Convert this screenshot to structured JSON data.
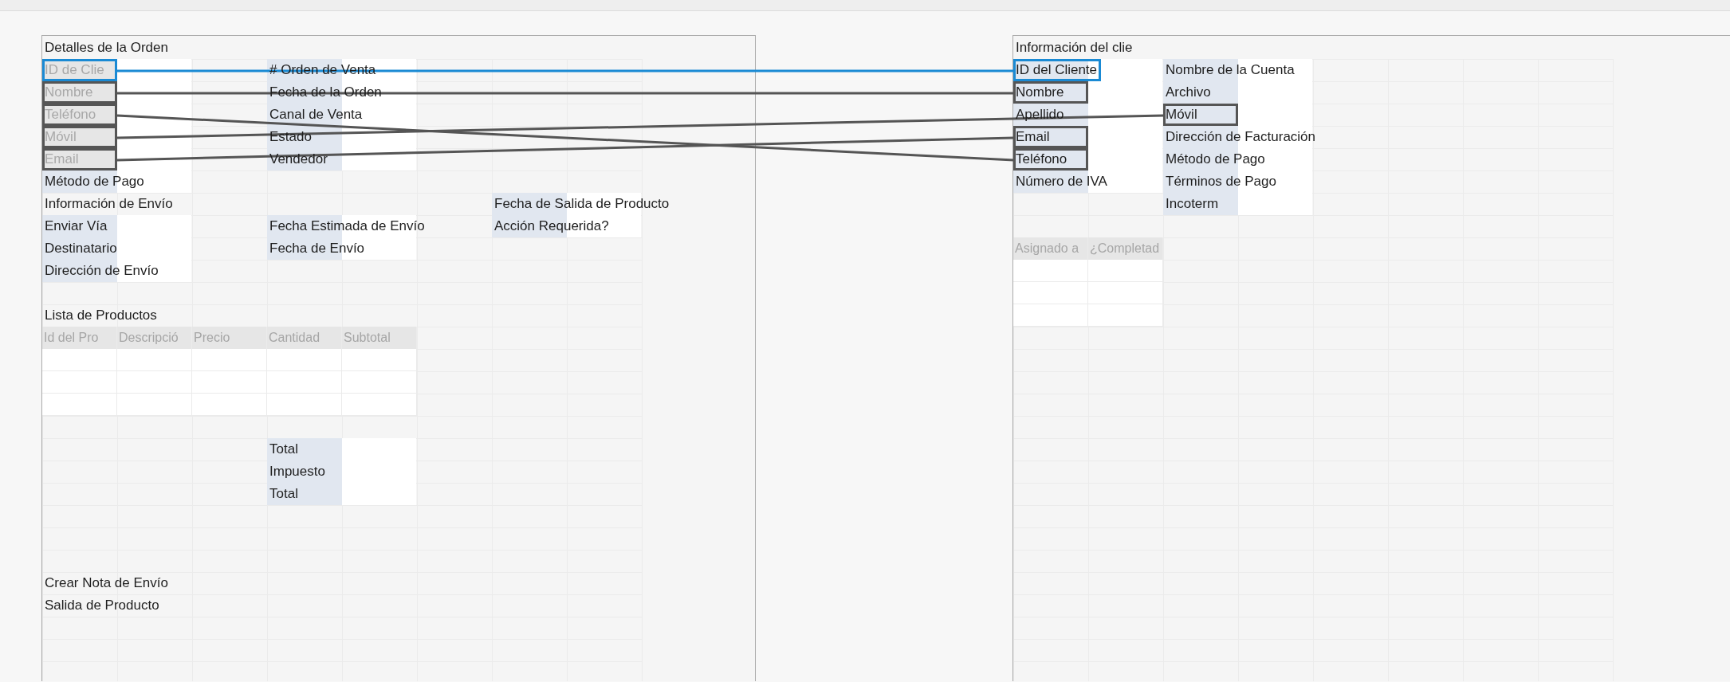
{
  "panels": [
    {
      "title": "Detalles de la Orden",
      "rows": [
        {
          "kind": "cells",
          "cells": [
            {
              "kind": "port",
              "text": "ID de Clie",
              "selected": true,
              "disabled": true
            },
            {
              "kind": "value"
            },
            {
              "kind": "gap"
            },
            {
              "kind": "label",
              "text": "# Orden de Venta"
            },
            {
              "kind": "value"
            }
          ]
        },
        {
          "kind": "cells",
          "cells": [
            {
              "kind": "port",
              "text": "Nombre",
              "selected": false,
              "disabled": true
            },
            {
              "kind": "value"
            },
            {
              "kind": "gap"
            },
            {
              "kind": "label",
              "text": "Fecha de la Orden"
            },
            {
              "kind": "value"
            }
          ]
        },
        {
          "kind": "cells",
          "cells": [
            {
              "kind": "port",
              "text": "Teléfono",
              "selected": false,
              "disabled": true
            },
            {
              "kind": "value"
            },
            {
              "kind": "gap"
            },
            {
              "kind": "label",
              "text": "Canal de Venta"
            },
            {
              "kind": "value"
            }
          ]
        },
        {
          "kind": "cells",
          "cells": [
            {
              "kind": "port",
              "text": "Móvil",
              "selected": false,
              "disabled": true
            },
            {
              "kind": "value"
            },
            {
              "kind": "gap"
            },
            {
              "kind": "label",
              "text": "Estado"
            },
            {
              "kind": "value"
            }
          ]
        },
        {
          "kind": "cells",
          "cells": [
            {
              "kind": "port",
              "text": "Email",
              "selected": false,
              "disabled": true
            },
            {
              "kind": "value"
            },
            {
              "kind": "gap"
            },
            {
              "kind": "label",
              "text": "Vendedor"
            },
            {
              "kind": "value"
            }
          ]
        },
        {
          "kind": "cells",
          "cells": [
            {
              "kind": "label",
              "text": "Método de Pago"
            },
            {
              "kind": "value"
            }
          ]
        },
        {
          "kind": "cells",
          "cells": [
            {
              "kind": "text",
              "text": "Información de Envío"
            },
            {
              "kind": "gap"
            },
            {
              "kind": "gap"
            },
            {
              "kind": "gap"
            },
            {
              "kind": "gap"
            },
            {
              "kind": "gap"
            },
            {
              "kind": "label",
              "text": "Fecha de Salida de Producto"
            },
            {
              "kind": "value"
            }
          ]
        },
        {
          "kind": "cells",
          "cells": [
            {
              "kind": "label",
              "text": "Enviar Vía"
            },
            {
              "kind": "value"
            },
            {
              "kind": "gap"
            },
            {
              "kind": "label",
              "text": "Fecha Estimada de Envío"
            },
            {
              "kind": "value"
            },
            {
              "kind": "gap"
            },
            {
              "kind": "label",
              "text": "Acción Requerida?"
            },
            {
              "kind": "value"
            }
          ]
        },
        {
          "kind": "cells",
          "cells": [
            {
              "kind": "label",
              "text": "Destinatario"
            },
            {
              "kind": "value"
            },
            {
              "kind": "gap"
            },
            {
              "kind": "label",
              "text": "Fecha de Envío"
            },
            {
              "kind": "value"
            }
          ]
        },
        {
          "kind": "cells",
          "cells": [
            {
              "kind": "label",
              "text": "Dirección de Envío"
            },
            {
              "kind": "value"
            }
          ]
        },
        {
          "kind": "blank"
        },
        {
          "kind": "cells",
          "cells": [
            {
              "kind": "text",
              "text": "Lista de Productos"
            }
          ]
        },
        {
          "kind": "cells",
          "cells": [
            {
              "kind": "header",
              "text": "Id del Pro"
            },
            {
              "kind": "header",
              "text": "Descripció"
            },
            {
              "kind": "header",
              "text": "Precio"
            },
            {
              "kind": "header",
              "text": "Cantidad"
            },
            {
              "kind": "header",
              "text": "Subtotal"
            }
          ]
        },
        {
          "kind": "cells",
          "cells": [
            {
              "kind": "value"
            },
            {
              "kind": "value"
            },
            {
              "kind": "value"
            },
            {
              "kind": "value"
            },
            {
              "kind": "value"
            }
          ]
        },
        {
          "kind": "cells",
          "cells": [
            {
              "kind": "value"
            },
            {
              "kind": "value"
            },
            {
              "kind": "value"
            },
            {
              "kind": "value"
            },
            {
              "kind": "value"
            }
          ]
        },
        {
          "kind": "cells",
          "cells": [
            {
              "kind": "value"
            },
            {
              "kind": "value"
            },
            {
              "kind": "value"
            },
            {
              "kind": "value"
            },
            {
              "kind": "value"
            }
          ]
        },
        {
          "kind": "blank"
        },
        {
          "kind": "cells",
          "cells": [
            {
              "kind": "gap"
            },
            {
              "kind": "gap"
            },
            {
              "kind": "gap"
            },
            {
              "kind": "label",
              "text": "Total"
            },
            {
              "kind": "value"
            }
          ]
        },
        {
          "kind": "cells",
          "cells": [
            {
              "kind": "gap"
            },
            {
              "kind": "gap"
            },
            {
              "kind": "gap"
            },
            {
              "kind": "label",
              "text": "Impuesto"
            },
            {
              "kind": "value"
            }
          ]
        },
        {
          "kind": "cells",
          "cells": [
            {
              "kind": "gap"
            },
            {
              "kind": "gap"
            },
            {
              "kind": "gap"
            },
            {
              "kind": "label",
              "text": "Total"
            },
            {
              "kind": "value"
            }
          ]
        },
        {
          "kind": "blank"
        },
        {
          "kind": "blank"
        },
        {
          "kind": "blank"
        },
        {
          "kind": "cells",
          "cells": [
            {
              "kind": "text",
              "text": "Crear Nota de Envío"
            }
          ]
        },
        {
          "kind": "cells",
          "cells": [
            {
              "kind": "text",
              "text": "Salida de Producto"
            }
          ]
        }
      ]
    },
    {
      "title": "Información del clie",
      "rows": [
        {
          "kind": "cells",
          "cells": [
            {
              "kind": "port",
              "text": "ID del Cliente",
              "selected": true,
              "disabled": false
            },
            {
              "kind": "value"
            },
            {
              "kind": "label",
              "text": "Nombre de la Cuenta"
            },
            {
              "kind": "value"
            }
          ]
        },
        {
          "kind": "cells",
          "cells": [
            {
              "kind": "port",
              "text": "Nombre",
              "selected": false,
              "disabled": false
            },
            {
              "kind": "value"
            },
            {
              "kind": "label",
              "text": "Archivo"
            },
            {
              "kind": "value"
            }
          ]
        },
        {
          "kind": "cells",
          "cells": [
            {
              "kind": "label",
              "text": "Apellido"
            },
            {
              "kind": "value"
            },
            {
              "kind": "port",
              "text": "Móvil",
              "selected": false,
              "disabled": false
            },
            {
              "kind": "value"
            }
          ]
        },
        {
          "kind": "cells",
          "cells": [
            {
              "kind": "port",
              "text": "Email",
              "selected": false,
              "disabled": false
            },
            {
              "kind": "value"
            },
            {
              "kind": "label",
              "text": "Dirección de Facturación"
            },
            {
              "kind": "value"
            }
          ]
        },
        {
          "kind": "cells",
          "cells": [
            {
              "kind": "port",
              "text": "Teléfono",
              "selected": false,
              "disabled": false
            },
            {
              "kind": "value"
            },
            {
              "kind": "label",
              "text": "Método de Pago"
            },
            {
              "kind": "value"
            }
          ]
        },
        {
          "kind": "cells",
          "cells": [
            {
              "kind": "label",
              "text": "Número de IVA"
            },
            {
              "kind": "value"
            },
            {
              "kind": "label",
              "text": "Términos de Pago"
            },
            {
              "kind": "value"
            }
          ]
        },
        {
          "kind": "cells",
          "cells": [
            {
              "kind": "gap"
            },
            {
              "kind": "gap"
            },
            {
              "kind": "label",
              "text": "Incoterm"
            },
            {
              "kind": "value"
            }
          ]
        },
        {
          "kind": "blank"
        },
        {
          "kind": "cells",
          "cells": [
            {
              "kind": "header",
              "text": "Asignado a"
            },
            {
              "kind": "header",
              "text": "¿Completad"
            }
          ]
        },
        {
          "kind": "cells",
          "cells": [
            {
              "kind": "value"
            },
            {
              "kind": "value"
            }
          ]
        },
        {
          "kind": "cells",
          "cells": [
            {
              "kind": "value"
            },
            {
              "kind": "value"
            }
          ]
        },
        {
          "kind": "cells",
          "cells": [
            {
              "kind": "value"
            },
            {
              "kind": "value"
            }
          ]
        }
      ]
    }
  ],
  "links": [
    {
      "selected": true
    },
    {
      "selected": false
    },
    {
      "selected": false
    },
    {
      "selected": false
    },
    {
      "selected": false
    }
  ]
}
